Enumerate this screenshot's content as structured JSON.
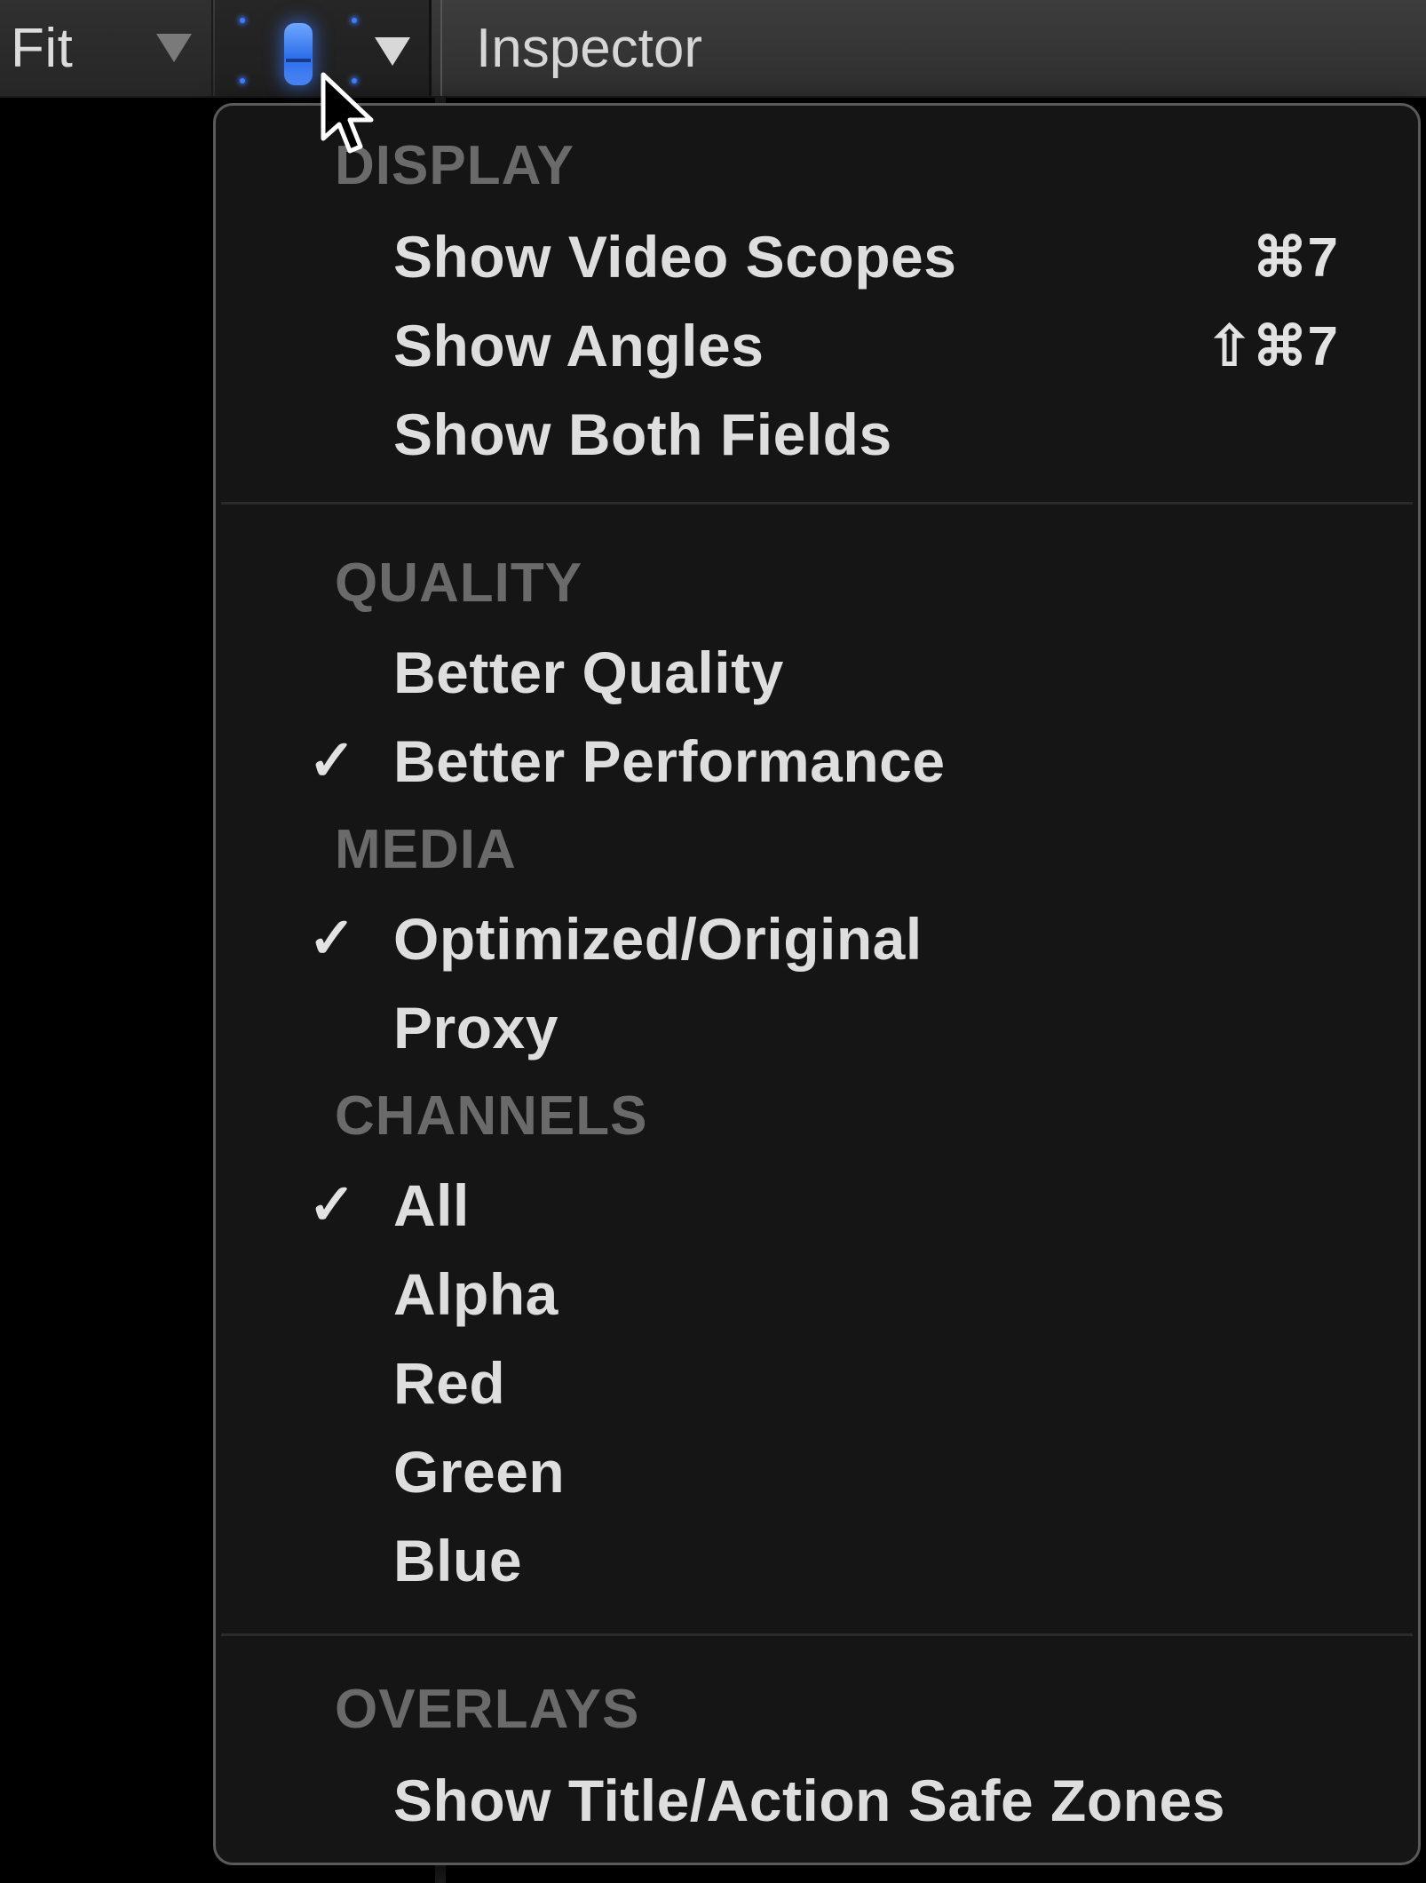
{
  "toolbar": {
    "fit_label": "Fit",
    "inspector_label": "Inspector"
  },
  "menu": {
    "sections": [
      {
        "header": "DISPLAY",
        "items": [
          {
            "label": "Show Video Scopes",
            "shortcut": "⌘7",
            "checked": false
          },
          {
            "label": "Show Angles",
            "shortcut": "⇧⌘7",
            "checked": false
          },
          {
            "label": "Show Both Fields",
            "shortcut": "",
            "checked": false
          }
        ]
      },
      {
        "header": "QUALITY",
        "items": [
          {
            "label": "Better Quality",
            "shortcut": "",
            "checked": false
          },
          {
            "label": "Better Performance",
            "shortcut": "",
            "checked": true
          }
        ]
      },
      {
        "header": "MEDIA",
        "items": [
          {
            "label": "Optimized/Original",
            "shortcut": "",
            "checked": true
          },
          {
            "label": "Proxy",
            "shortcut": "",
            "checked": false
          }
        ]
      },
      {
        "header": "CHANNELS",
        "items": [
          {
            "label": "All",
            "shortcut": "",
            "checked": true
          },
          {
            "label": "Alpha",
            "shortcut": "",
            "checked": false
          },
          {
            "label": "Red",
            "shortcut": "",
            "checked": false
          },
          {
            "label": "Green",
            "shortcut": "",
            "checked": false
          },
          {
            "label": "Blue",
            "shortcut": "",
            "checked": false
          }
        ]
      },
      {
        "header": "OVERLAYS",
        "items": [
          {
            "label": "Show Title/Action Safe Zones",
            "shortcut": "",
            "checked": false
          }
        ]
      }
    ],
    "check_glyph": "✓"
  },
  "icons": {
    "view_options": "view-options-icon",
    "dropdown": "chevron-down-icon",
    "cursor": "arrow-cursor-icon"
  },
  "colors": {
    "menu_bg": "#151515",
    "header_text": "#6a6a6a",
    "item_text": "#dedede",
    "accent_blue": "#3f7cff"
  }
}
